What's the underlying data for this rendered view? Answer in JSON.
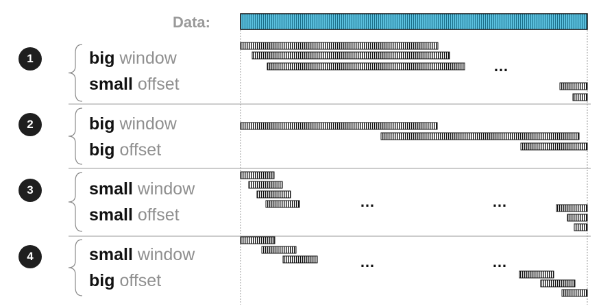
{
  "header": {
    "data_label": "Data:"
  },
  "colors": {
    "data_fill": "#5bc0de",
    "window_fill": "#ffffff",
    "stripe": "#111111",
    "row_separator": "#9a9a9a",
    "badge_bg": "#1f1f1f"
  },
  "scenarios": [
    {
      "number": "1",
      "line1_bold": "big",
      "line1_rest": " window",
      "line2_bold": "small",
      "line2_rest": " offset",
      "ellipsis": [
        "…"
      ]
    },
    {
      "number": "2",
      "line1_bold": "big",
      "line1_rest": " window",
      "line2_bold": "big",
      "line2_rest": " offset",
      "ellipsis": []
    },
    {
      "number": "3",
      "line1_bold": "small",
      "line1_rest": " window",
      "line2_bold": "small",
      "line2_rest": " offset",
      "ellipsis": [
        "…",
        "…"
      ]
    },
    {
      "number": "4",
      "line1_bold": "small",
      "line1_rest": " window",
      "line2_bold": "big",
      "line2_rest": " offset",
      "ellipsis": [
        "…",
        "…"
      ]
    }
  ]
}
